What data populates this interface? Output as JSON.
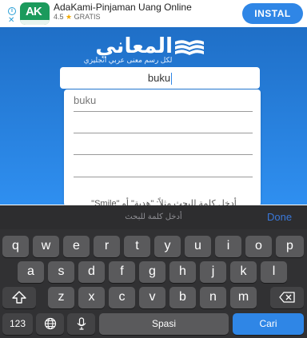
{
  "ad": {
    "app_name": "AdaKami-Pinjaman Uang Online",
    "rating": "4.5",
    "star": "★",
    "price": "GRATIS",
    "install_label": "INSTAL",
    "info_icon": "info-icon",
    "close_icon": "close-icon",
    "brand_color": "#1b9a5c",
    "button_color": "#2f86e6"
  },
  "header": {
    "brand_name": "المعاني",
    "tagline": "لكل رسم معنى  عربي انجليزي",
    "accent": "#2f8ff0"
  },
  "search": {
    "value": "buku"
  },
  "suggestions": [
    {
      "label": "buku"
    },
    {
      "label": ""
    },
    {
      "label": ""
    },
    {
      "label": ""
    }
  ],
  "instruction": "أدخل كلمة للبحث مثلاً: \"هدية\" أو \"Smile\"",
  "keyboard": {
    "hint": "أدخل كلمة للبحث",
    "done_label": "Done",
    "row1": [
      "q",
      "w",
      "e",
      "r",
      "t",
      "y",
      "u",
      "i",
      "o",
      "p"
    ],
    "row2": [
      "a",
      "s",
      "d",
      "f",
      "g",
      "h",
      "j",
      "k",
      "l"
    ],
    "row3": [
      "z",
      "x",
      "c",
      "v",
      "b",
      "n",
      "m"
    ],
    "shift_icon": "shift-icon",
    "backspace_icon": "backspace-icon",
    "numbers_label": "123",
    "globe_icon": "globe-icon",
    "mic_icon": "microphone-icon",
    "space_label": "Spasi",
    "search_label": "Cari"
  }
}
